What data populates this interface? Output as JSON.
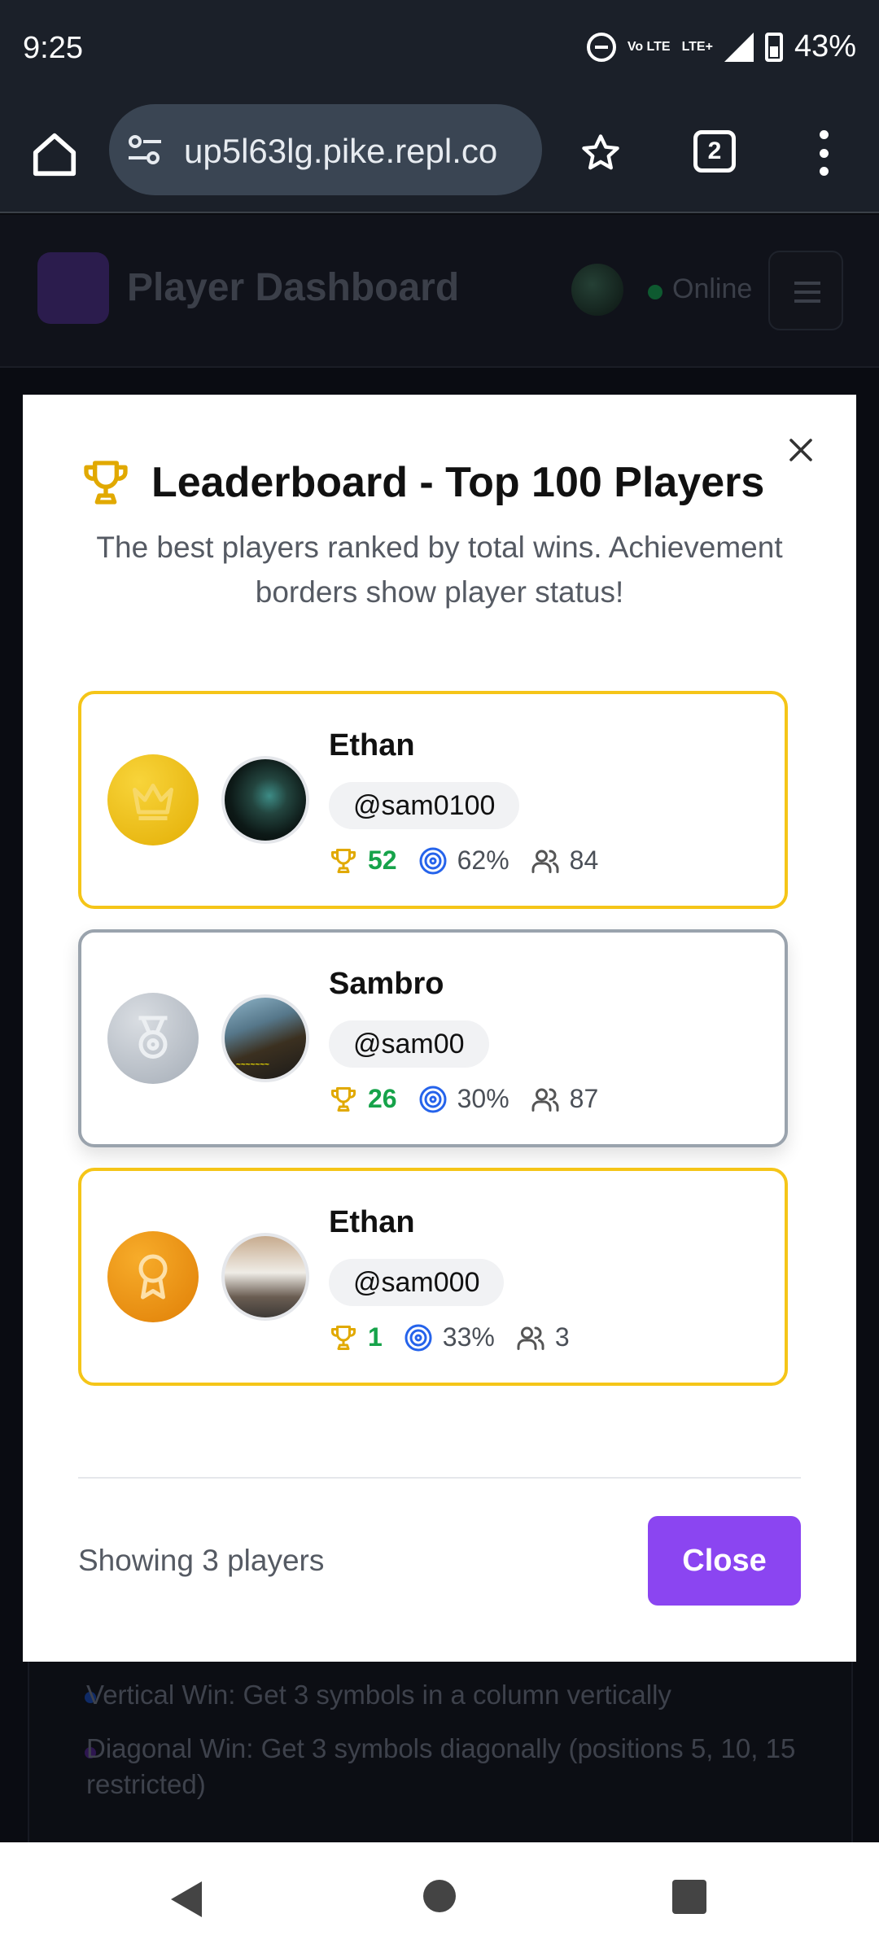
{
  "status_bar": {
    "time": "9:25",
    "volte": "Vo LTE",
    "lte": "LTE+",
    "battery": "43%"
  },
  "browser": {
    "url": "up5l63lg.pike.repl.co",
    "tab_count": "2"
  },
  "app": {
    "title": "Player Dashboard",
    "status": "Online",
    "rules": [
      {
        "text": "Vertical Win: Get 3 symbols in a column vertically",
        "color": "#0f2a66"
      },
      {
        "text": "Diagonal Win: Get 3 symbols diagonally (positions 5, 10, 15 restricted)",
        "color": "#2d1650"
      }
    ]
  },
  "modal": {
    "title": "Leaderboard - Top 100 Players",
    "description": "The best players ranked by total wins. Achievement borders show player status!",
    "players": [
      {
        "rank_icon": "crown-icon",
        "border": "gold",
        "name": "Ethan",
        "handle": "@sam0100",
        "wins": "52",
        "win_rate": "62%",
        "friends": "84"
      },
      {
        "rank_icon": "medal-icon",
        "border": "silver",
        "name": "Sambro",
        "handle": "@sam00",
        "wins": "26",
        "win_rate": "30%",
        "friends": "87"
      },
      {
        "rank_icon": "award-icon",
        "border": "gold",
        "name": "Ethan",
        "handle": "@sam000",
        "wins": "1",
        "win_rate": "33%",
        "friends": "3"
      }
    ],
    "footer_text": "Showing 3 players",
    "close_label": "Close"
  },
  "colors": {
    "accent": "#8b45f1",
    "gold": "#f5c518",
    "silver": "#9aa3ad",
    "wins_green": "#16a34a"
  }
}
